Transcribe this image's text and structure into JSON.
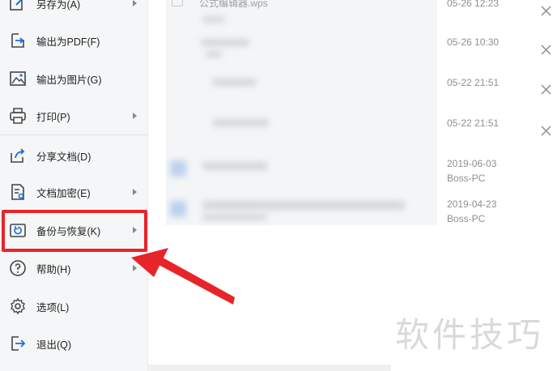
{
  "menu": {
    "items": [
      {
        "label": "另存为(A)",
        "icon": "save-as-icon",
        "has_submenu": true
      },
      {
        "label": "输出为PDF(F)",
        "icon": "pdf-export-icon",
        "has_submenu": false
      },
      {
        "label": "输出为图片(G)",
        "icon": "image-export-icon",
        "has_submenu": false
      },
      {
        "label": "打印(P)",
        "icon": "printer-icon",
        "has_submenu": true
      },
      {
        "label": "分享文档(D)",
        "icon": "share-icon",
        "has_submenu": false
      },
      {
        "label": "文档加密(E)",
        "icon": "encrypt-doc-icon",
        "has_submenu": true
      },
      {
        "label": "备份与恢复(K)",
        "icon": "backup-restore-icon",
        "has_submenu": true
      },
      {
        "label": "帮助(H)",
        "icon": "help-icon",
        "has_submenu": true
      },
      {
        "label": "选项(L)",
        "icon": "gear-icon",
        "has_submenu": false
      },
      {
        "label": "退出(Q)",
        "icon": "exit-icon",
        "has_submenu": false
      }
    ]
  },
  "files": {
    "first_name": "公式编辑器.wps",
    "rows": [
      {
        "time": "05-26 12:23"
      },
      {
        "time": "05-26 10:30"
      },
      {
        "time": "05-22 21:51"
      },
      {
        "time": "05-22 21:51"
      },
      {
        "time": "2019-06-03",
        "device": "Boss-PC"
      },
      {
        "time": "2019-04-23",
        "device": "Boss-PC"
      }
    ]
  },
  "watermark": "软件技巧",
  "colors": {
    "highlight": "#e6252a",
    "menu_bg": "#f5f6f7"
  }
}
